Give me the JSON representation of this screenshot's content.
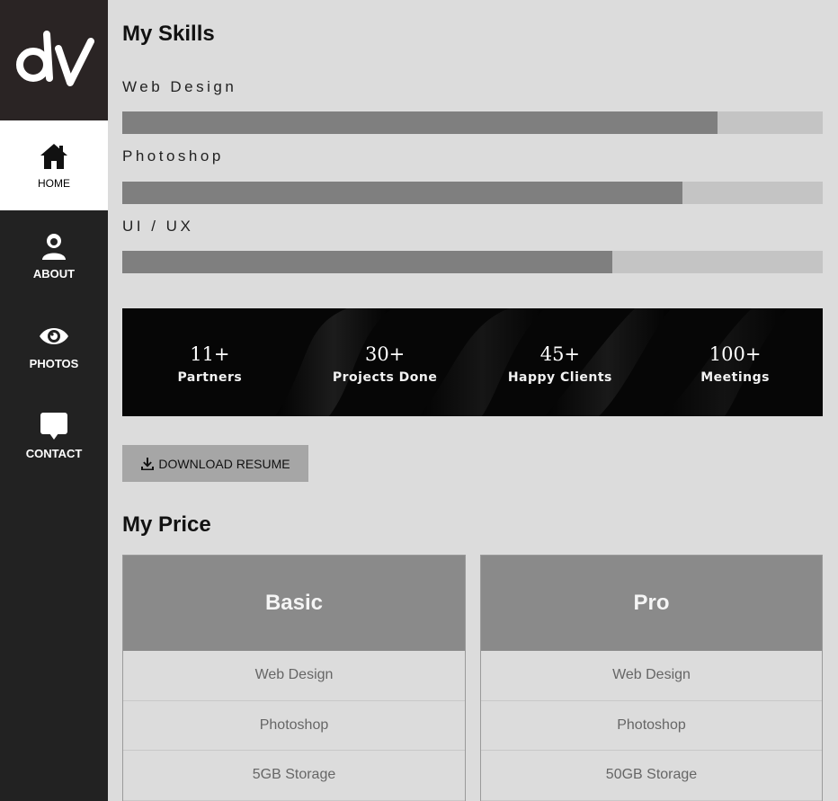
{
  "sidebar": {
    "logo_text": "dv",
    "items": [
      {
        "label": "HOME",
        "icon": "home-icon",
        "active": true
      },
      {
        "label": "ABOUT",
        "icon": "user-icon",
        "active": false
      },
      {
        "label": "PHOTOS",
        "icon": "eye-icon",
        "active": false
      },
      {
        "label": "CONTACT",
        "icon": "chat-icon",
        "active": false
      }
    ]
  },
  "skills": {
    "title": "My Skills",
    "items": [
      {
        "name": "Web Design",
        "level": 0.85
      },
      {
        "name": "Photoshop",
        "level": 0.8
      },
      {
        "name": "UI / UX",
        "level": 0.7
      }
    ]
  },
  "stats": [
    {
      "value": "11+",
      "label": "Partners"
    },
    {
      "value": "30+",
      "label": "Projects Done"
    },
    {
      "value": "45+",
      "label": "Happy Clients"
    },
    {
      "value": "100+",
      "label": "Meetings"
    }
  ],
  "download": {
    "label": "DOWNLOAD RESUME",
    "icon": "download-icon"
  },
  "price": {
    "title": "My Price",
    "plans": [
      {
        "name": "Basic",
        "features": [
          "Web Design",
          "Photoshop",
          "5GB Storage"
        ]
      },
      {
        "name": "Pro",
        "features": [
          "Web Design",
          "Photoshop",
          "50GB Storage"
        ]
      }
    ]
  },
  "colors": {
    "sidebar_bg": "#222222",
    "page_bg": "#dcdcdc",
    "bar_fill": "#7f7f7f",
    "bar_track": "#c4c4c4",
    "price_head": "#8a8a8a"
  }
}
